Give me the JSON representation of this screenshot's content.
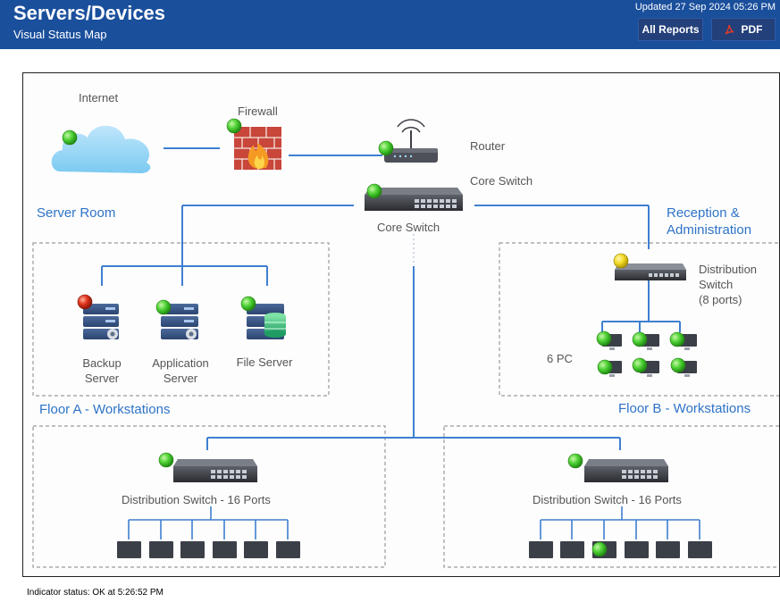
{
  "header": {
    "title": "Servers/Devices",
    "subtitle": "Visual Status Map",
    "updated": "Updated 27 Sep 2024 05:26 PM",
    "all_reports_label": "All Reports",
    "pdf_label": "PDF",
    "bg_color": "#1a4f9c"
  },
  "map": {
    "labels": {
      "internet": "Internet",
      "firewall": "Firewall",
      "router": "Router",
      "core_switch_right": "Core Switch",
      "core_switch_below": "Core Switch",
      "server_room": "Server Room",
      "reception_line1": "Reception &",
      "reception_line2": "Administration",
      "dist_switch_line1": "Distribution",
      "dist_switch_line2": "Switch",
      "dist_switch_line3": "(8 ports)",
      "backup_line1": "Backup",
      "backup_line2": "Server",
      "application_line1": "Application",
      "application_line2": "Server",
      "file_server": "File Server",
      "six_pc": "6 PC",
      "floor_a": "Floor A - Workstations",
      "floor_b": "Floor B - Workstations",
      "dist16_a": "Distribution Switch - 16 Ports",
      "dist16_b": "Distribution Switch - 16 Ports"
    },
    "status_colors": {
      "ok": "#3fbf2e",
      "warning": "#f2d21c",
      "down": "#d32f1e"
    },
    "accent_blue": "#2e73c8",
    "indicators": {
      "internet": "ok",
      "firewall": "ok",
      "router": "ok",
      "core_switch": "ok",
      "distribution_switch_8": "warning",
      "backup_server": "down",
      "application_server": "ok",
      "file_server": "ok",
      "pc_1": "ok",
      "pc_2": "ok",
      "pc_3": "ok",
      "pc_4": "ok",
      "pc_5": "ok",
      "pc_6": "ok",
      "dist_switch_16_a": "ok",
      "dist_switch_16_b": "ok",
      "floor_b_workstation": "ok"
    }
  },
  "footer": {
    "status_text": "Indicator status: OK at 5:26:52 PM"
  }
}
